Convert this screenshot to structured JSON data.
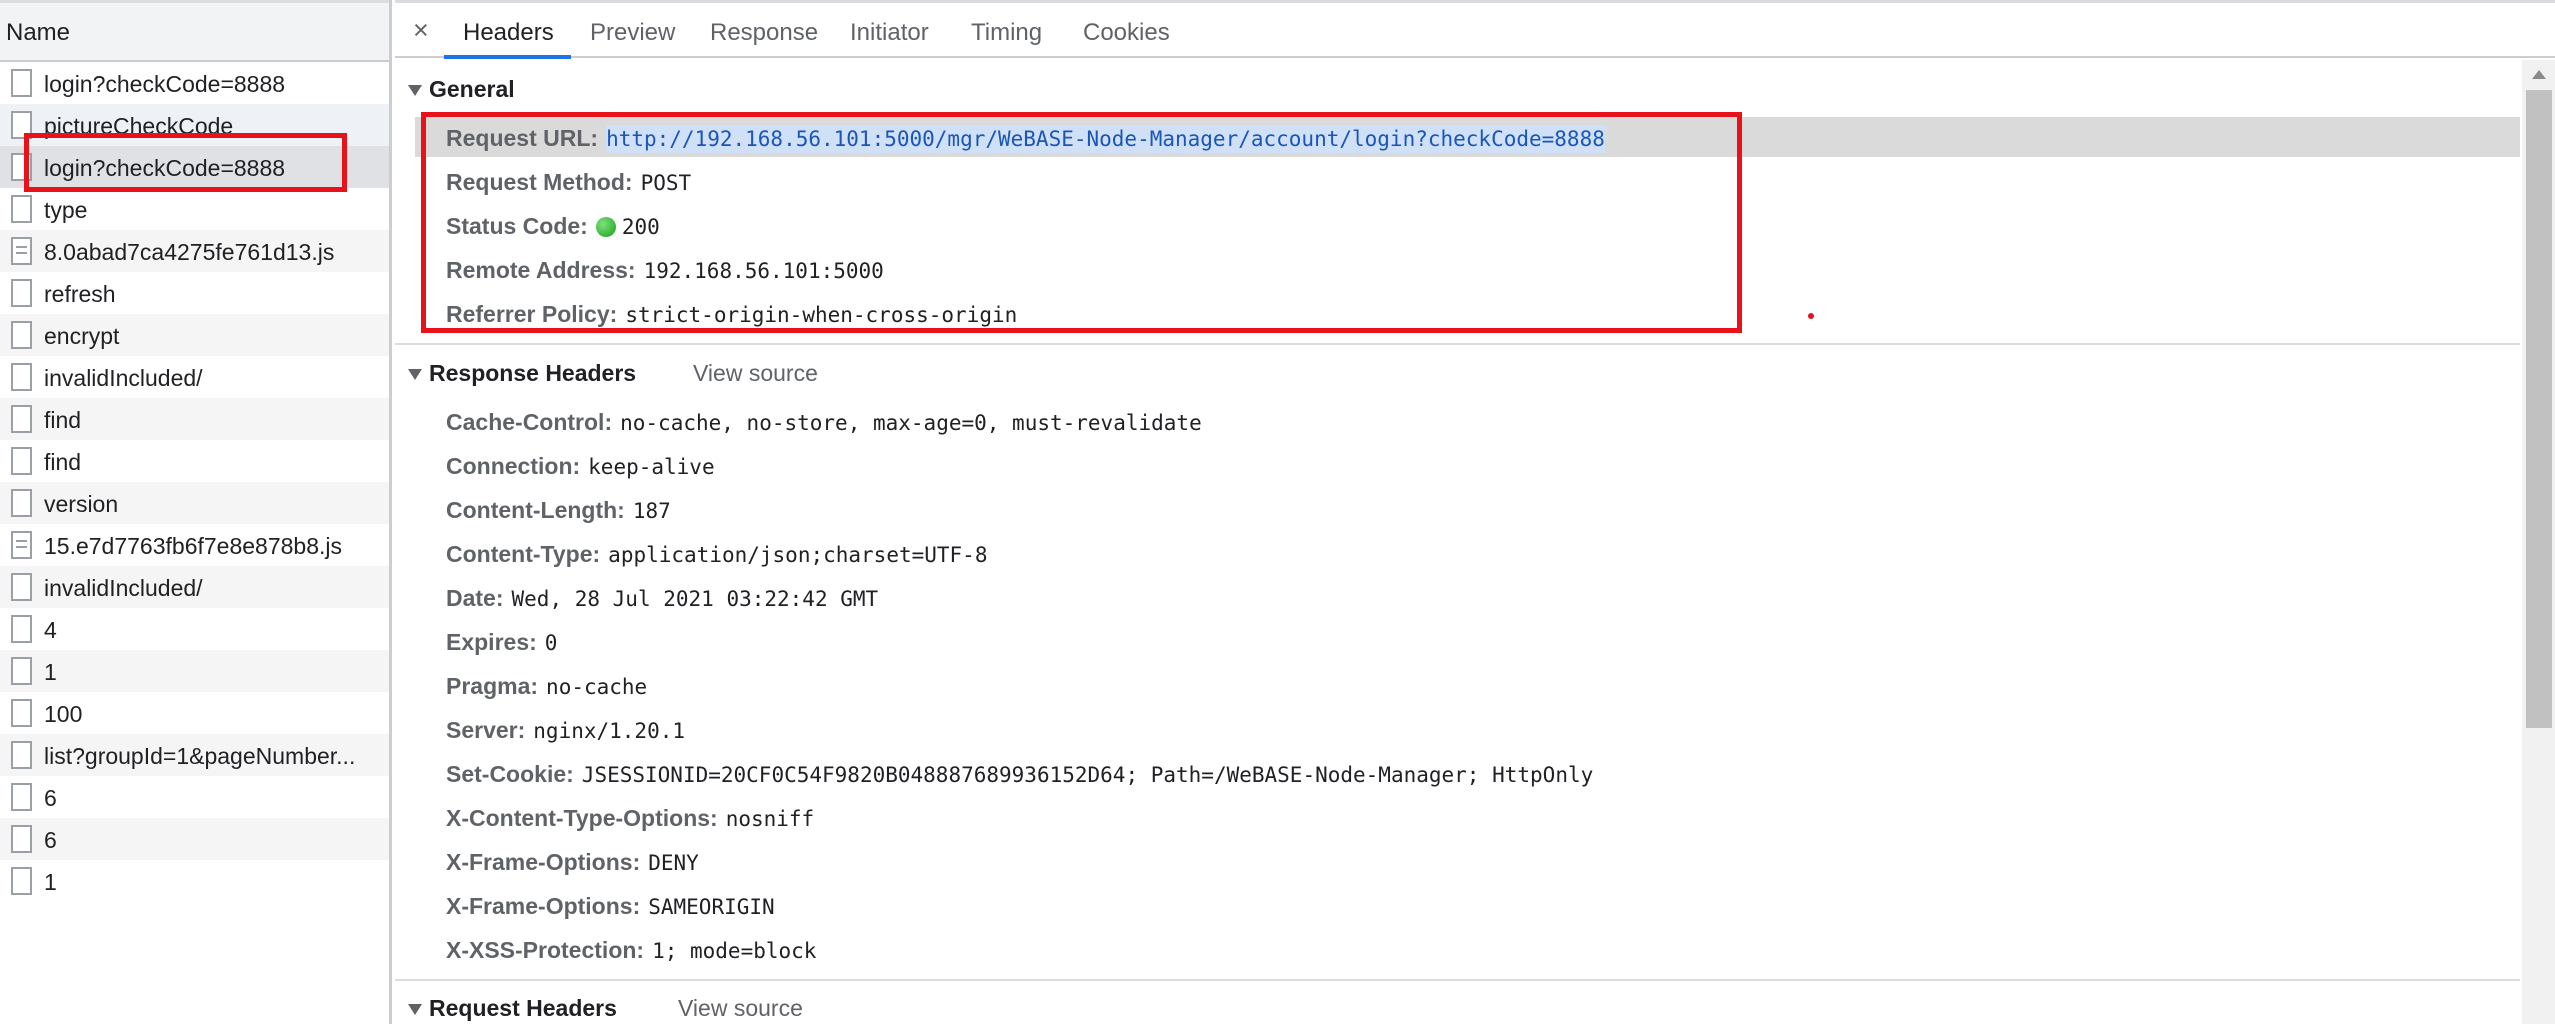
{
  "name_column": {
    "header": "Name"
  },
  "requests": [
    {
      "label": "login?checkCode=8888",
      "js": false
    },
    {
      "label": "pictureCheckCode",
      "js": false
    },
    {
      "label": "login?checkCode=8888",
      "js": false
    },
    {
      "label": "type",
      "js": false
    },
    {
      "label": "8.0abad7ca4275fe761d13.js",
      "js": true
    },
    {
      "label": "refresh",
      "js": false
    },
    {
      "label": "encrypt",
      "js": false
    },
    {
      "label": "invalidIncluded/",
      "js": false
    },
    {
      "label": "find",
      "js": false
    },
    {
      "label": "find",
      "js": false
    },
    {
      "label": "version",
      "js": false
    },
    {
      "label": "15.e7d7763fb6f7e8e878b8.js",
      "js": true
    },
    {
      "label": "invalidIncluded/",
      "js": false
    },
    {
      "label": "4",
      "js": false
    },
    {
      "label": "1",
      "js": false
    },
    {
      "label": "100",
      "js": false
    },
    {
      "label": "list?groupId=1&pageNumber...",
      "js": false
    },
    {
      "label": "6",
      "js": false
    },
    {
      "label": "6",
      "js": false
    },
    {
      "label": "1",
      "js": false
    }
  ],
  "tabs": {
    "close": "×",
    "headers": "Headers",
    "preview": "Preview",
    "response": "Response",
    "initiator": "Initiator",
    "timing": "Timing",
    "cookies": "Cookies"
  },
  "general": {
    "title": "General",
    "request_url_label": "Request URL:",
    "request_url": "http://192.168.56.101:5000/mgr/WeBASE-Node-Manager/account/login?checkCode=8888",
    "request_method_label": "Request Method:",
    "request_method": "POST",
    "status_code_label": "Status Code:",
    "status_code": "200",
    "remote_address_label": "Remote Address:",
    "remote_address": "192.168.56.101:5000",
    "referrer_policy_label": "Referrer Policy:",
    "referrer_policy": "strict-origin-when-cross-origin"
  },
  "response_headers": {
    "title": "Response Headers",
    "view_source": "View source",
    "items": [
      {
        "k": "Cache-Control:",
        "v": "no-cache, no-store, max-age=0, must-revalidate"
      },
      {
        "k": "Connection:",
        "v": "keep-alive"
      },
      {
        "k": "Content-Length:",
        "v": "187"
      },
      {
        "k": "Content-Type:",
        "v": "application/json;charset=UTF-8"
      },
      {
        "k": "Date:",
        "v": "Wed, 28 Jul 2021 03:22:42 GMT"
      },
      {
        "k": "Expires:",
        "v": "0"
      },
      {
        "k": "Pragma:",
        "v": "no-cache"
      },
      {
        "k": "Server:",
        "v": "nginx/1.20.1"
      },
      {
        "k": "Set-Cookie:",
        "v": "JSESSIONID=20CF0C54F9820B048887689936152D64; Path=/WeBASE-Node-Manager; HttpOnly"
      },
      {
        "k": "X-Content-Type-Options:",
        "v": "nosniff"
      },
      {
        "k": "X-Frame-Options:",
        "v": "DENY"
      },
      {
        "k": "X-Frame-Options:",
        "v": "SAMEORIGIN"
      },
      {
        "k": "X-XSS-Protection:",
        "v": "1; mode=block"
      }
    ]
  },
  "request_headers": {
    "title": "Request Headers",
    "view_source": "View source"
  },
  "colors": {
    "annotation_red": "#e8121a",
    "status_green": "#15a115",
    "tab_accent": "#1a73e8"
  }
}
